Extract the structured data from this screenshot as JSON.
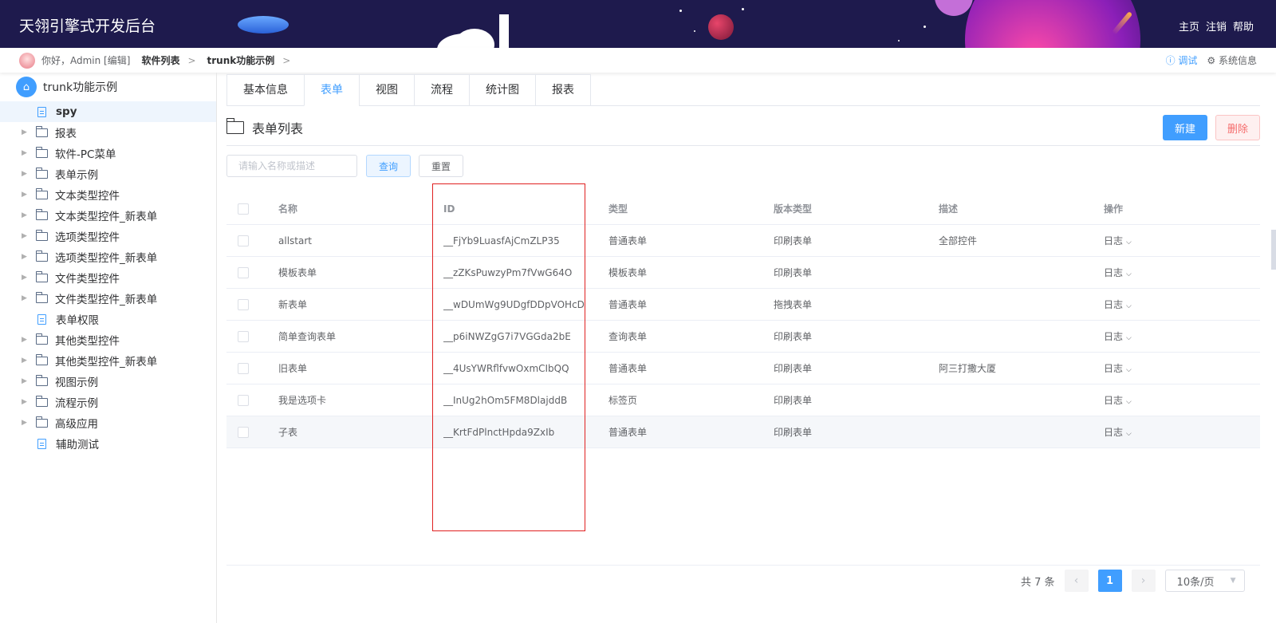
{
  "header": {
    "app_title": "天翎引擎式开发后台",
    "links": [
      "主页",
      "注销",
      "帮助"
    ]
  },
  "breadcrumb": {
    "greeting": "你好，Admin [编辑]",
    "items": [
      "软件列表",
      "trunk功能示例"
    ],
    "separator": ">",
    "debug": "调试",
    "sysinfo": "系统信息"
  },
  "sidebar": {
    "root": "trunk功能示例",
    "items": [
      {
        "label": "spy",
        "type": "doc",
        "selected": true
      },
      {
        "label": "报表",
        "type": "folder"
      },
      {
        "label": "软件-PC菜单",
        "type": "folder"
      },
      {
        "label": "表单示例",
        "type": "folder"
      },
      {
        "label": "文本类型控件",
        "type": "folder"
      },
      {
        "label": "文本类型控件_新表单",
        "type": "folder"
      },
      {
        "label": "选项类型控件",
        "type": "folder"
      },
      {
        "label": "选项类型控件_新表单",
        "type": "folder"
      },
      {
        "label": "文件类型控件",
        "type": "folder"
      },
      {
        "label": "文件类型控件_新表单",
        "type": "folder"
      },
      {
        "label": "表单权限",
        "type": "doc"
      },
      {
        "label": "其他类型控件",
        "type": "folder"
      },
      {
        "label": "其他类型控件_新表单",
        "type": "folder"
      },
      {
        "label": "视图示例",
        "type": "folder"
      },
      {
        "label": "流程示例",
        "type": "folder"
      },
      {
        "label": "高级应用",
        "type": "folder"
      },
      {
        "label": "辅助测试",
        "type": "doc"
      }
    ]
  },
  "tabs": [
    "基本信息",
    "表单",
    "视图",
    "流程",
    "统计图",
    "报表"
  ],
  "active_tab": "表单",
  "section_title": "表单列表",
  "actions": {
    "new": "新建",
    "delete": "删除"
  },
  "search": {
    "placeholder": "请输入名称或描述",
    "query": "查询",
    "reset": "重置"
  },
  "table": {
    "columns": [
      "名称",
      "ID",
      "类型",
      "版本类型",
      "描述",
      "操作"
    ],
    "rows": [
      {
        "name": "allstart",
        "id": "__FjYb9LuasfAjCmZLP35",
        "type": "普通表单",
        "version": "印刷表单",
        "desc": "全部控件",
        "op": "日志"
      },
      {
        "name": "模板表单",
        "id": "__zZKsPuwzyPm7fVwG64O",
        "type": "模板表单",
        "version": "印刷表单",
        "desc": "",
        "op": "日志"
      },
      {
        "name": "新表单",
        "id": "__wDUmWg9UDgfDDpVOHcD",
        "type": "普通表单",
        "version": "拖拽表单",
        "desc": "",
        "op": "日志"
      },
      {
        "name": "简单查询表单",
        "id": "__p6iNWZgG7i7VGGda2bE",
        "type": "查询表单",
        "version": "印刷表单",
        "desc": "",
        "op": "日志"
      },
      {
        "name": "旧表单",
        "id": "__4UsYWRflfvwOxmCIbQQ",
        "type": "普通表单",
        "version": "印刷表单",
        "desc": "阿三打撒大厦",
        "op": "日志"
      },
      {
        "name": "我是选项卡",
        "id": "__InUg2hOm5FM8DlajddB",
        "type": "标签页",
        "version": "印刷表单",
        "desc": "",
        "op": "日志"
      },
      {
        "name": "子表",
        "id": "__KrtFdPlnctHpda9ZxIb",
        "type": "普通表单",
        "version": "印刷表单",
        "desc": "",
        "op": "日志"
      }
    ]
  },
  "pager": {
    "total": "共 7 条",
    "current": "1",
    "size": "10条/页",
    "prev": "‹",
    "next": "›"
  },
  "colors": {
    "primary": "#409eff",
    "danger": "#f56c6c",
    "header_bg": "#1e1a4d",
    "highlight": "#e02020"
  }
}
